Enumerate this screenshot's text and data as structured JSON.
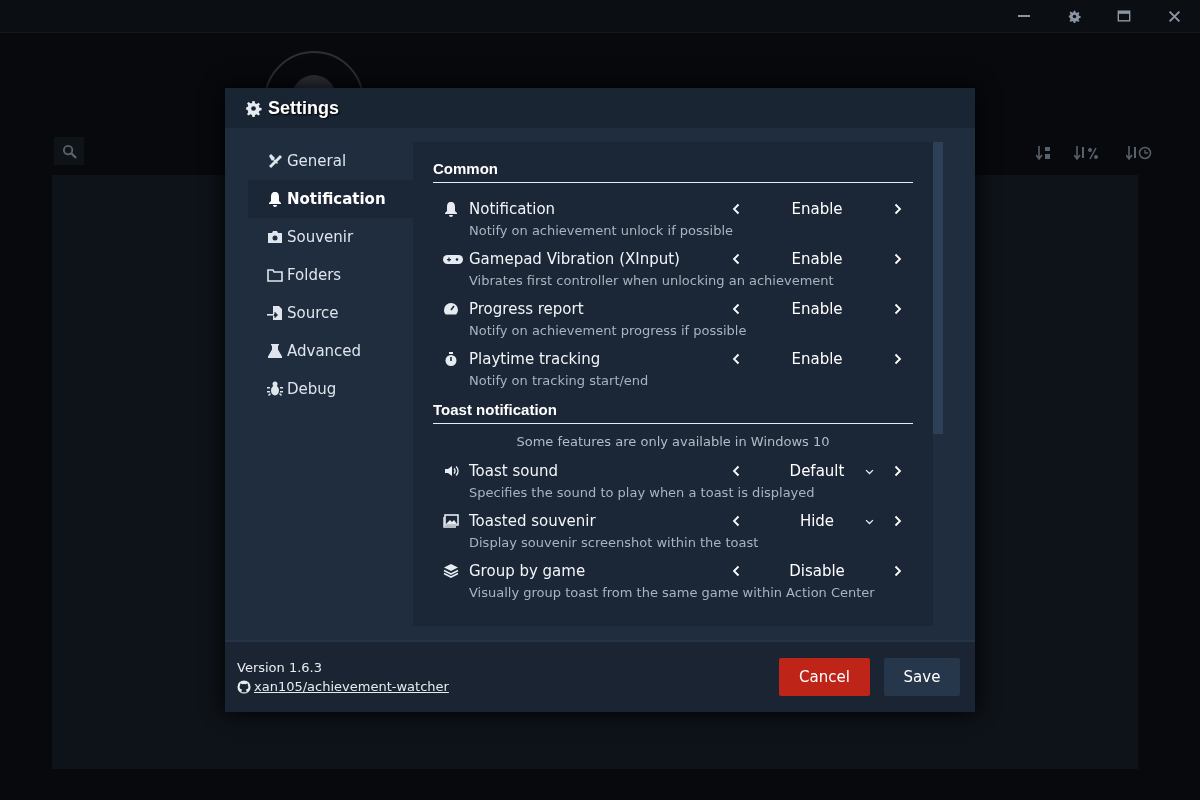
{
  "dialog": {
    "title": "Settings",
    "sidebar": [
      {
        "label": "General",
        "selected": false
      },
      {
        "label": "Notification",
        "selected": true
      },
      {
        "label": "Souvenir",
        "selected": false
      },
      {
        "label": "Folders",
        "selected": false
      },
      {
        "label": "Source",
        "selected": false
      },
      {
        "label": "Advanced",
        "selected": false
      },
      {
        "label": "Debug",
        "selected": false
      }
    ],
    "sections": [
      {
        "title": "Common",
        "options": [
          {
            "label": "Notification",
            "description": "Notify on achievement unlock if possible",
            "value": "Enable",
            "dropdown": false
          },
          {
            "label": "Gamepad Vibration (XInput)",
            "description": "Vibrates first controller when unlocking an achievement",
            "value": "Enable",
            "dropdown": false
          },
          {
            "label": "Progress report",
            "description": "Notify on achievement progress if possible",
            "value": "Enable",
            "dropdown": false
          },
          {
            "label": "Playtime tracking",
            "description": "Notify on tracking start/end",
            "value": "Enable",
            "dropdown": false
          }
        ]
      },
      {
        "title": "Toast notification",
        "note": "Some features are only available in Windows 10",
        "options": [
          {
            "label": "Toast sound",
            "description": "Specifies the sound to play when a toast is displayed",
            "value": "Default",
            "dropdown": true
          },
          {
            "label": "Toasted souvenir",
            "description": "Display souvenir screenshot within the toast",
            "value": "Hide",
            "dropdown": true
          },
          {
            "label": "Group by game",
            "description": "Visually group toast from the same game within Action Center",
            "value": "Disable",
            "dropdown": false
          }
        ]
      }
    ],
    "footer": {
      "version": "Version 1.6.3",
      "link": "xan105/achievement-watcher"
    },
    "buttons": [
      {
        "label": "Cancel",
        "kind": "danger"
      },
      {
        "label": "Save",
        "kind": "default"
      }
    ]
  }
}
